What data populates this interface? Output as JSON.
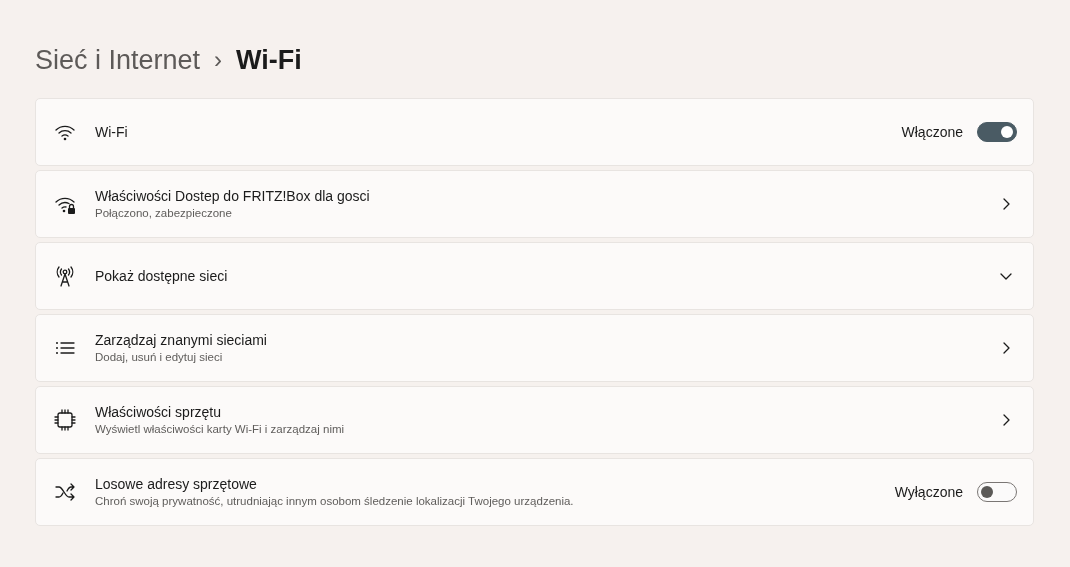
{
  "breadcrumb": {
    "parent": "Sieć i Internet",
    "separator": "›",
    "current": "Wi-Fi"
  },
  "rows": [
    {
      "kind": "toggle",
      "title": "Wi-Fi",
      "status": "Włączone",
      "on": true
    },
    {
      "kind": "link",
      "title": "Właściwości Dostep do FRITZ!Box dla gosci",
      "subtitle": "Połączono, zabezpieczone"
    },
    {
      "kind": "expand",
      "title": "Pokaż dostępne sieci",
      "expanded": false
    },
    {
      "kind": "link",
      "title": "Zarządzaj znanymi sieciami",
      "subtitle": "Dodaj, usuń i edytuj sieci"
    },
    {
      "kind": "link",
      "title": "Właściwości sprzętu",
      "subtitle": "Wyświetl właściwości karty Wi-Fi i zarządzaj nimi"
    },
    {
      "kind": "toggle",
      "title": "Losowe adresy sprzętowe",
      "subtitle": "Chroń swoją prywatność, utrudniając innym osobom śledzenie lokalizacji Twojego urządzenia.",
      "status": "Wyłączone",
      "on": false
    }
  ]
}
